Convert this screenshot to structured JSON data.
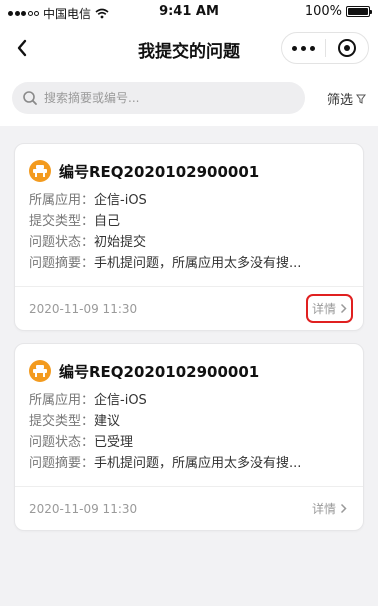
{
  "status_bar": {
    "carrier": "中国电信",
    "time": "9:41 AM",
    "battery": "100%",
    "battery_level": 1.0
  },
  "nav": {
    "title": "我提交的问题"
  },
  "search": {
    "placeholder": "搜索摘要或编号...",
    "value": ""
  },
  "filter": {
    "label": "筛选"
  },
  "colors": {
    "accent_badge": "#f39b1f",
    "highlight_box": "#e02020"
  },
  "cards": [
    {
      "title": "编号REQ2020102900001",
      "rows": [
        {
          "key": "所属应用：",
          "value": "企信-iOS"
        },
        {
          "key": "提交类型：",
          "value": "自己"
        },
        {
          "key": "问题状态：",
          "value": "初始提交"
        },
        {
          "key": "问题摘要：",
          "value": "手机提问题，所属应用太多没有搜..."
        }
      ],
      "date": "2020-11-09  11:30",
      "detail": "详情"
    },
    {
      "title": "编号REQ2020102900001",
      "rows": [
        {
          "key": "所属应用：",
          "value": "企信-iOS"
        },
        {
          "key": "提交类型：",
          "value": "建议"
        },
        {
          "key": "问题状态：",
          "value": "已受理"
        },
        {
          "key": "问题摘要：",
          "value": "手机提问题，所属应用太多没有搜..."
        }
      ],
      "date": "2020-11-09  11:30",
      "detail": "详情"
    }
  ]
}
